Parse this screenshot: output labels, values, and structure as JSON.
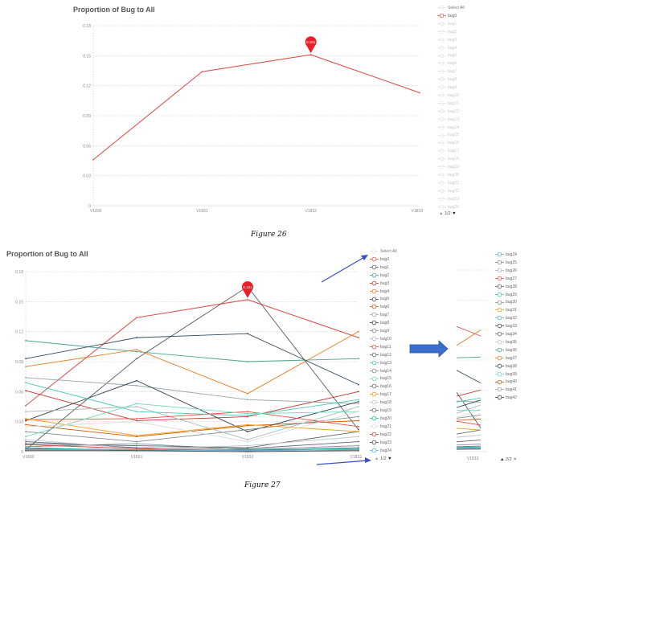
{
  "figure26": {
    "title": "Proportion of Bug to All",
    "caption": "Figure 26",
    "legend": {
      "select_all": "Select All",
      "items": [
        "bug0",
        "bug1",
        "bug2",
        "bug3",
        "bug4",
        "bug5",
        "bug6",
        "bug7",
        "bug8",
        "bug9",
        "bug10",
        "bug11",
        "bug12",
        "bug13",
        "bug14",
        "bug15",
        "bug16",
        "bug17",
        "bug18",
        "bug19",
        "bug20",
        "bug21",
        "bug22",
        "bug23",
        "bug24"
      ],
      "active": [
        "bug0"
      ],
      "pager": "1/2"
    }
  },
  "figure27": {
    "title": "Proportion of Bug to All",
    "caption": "Figure 27",
    "legend": {
      "select_all": "Select All",
      "items": [
        "bug0",
        "bug1",
        "bug2",
        "bug3",
        "bug4",
        "bug5",
        "bug6",
        "bug7",
        "bug8",
        "bug9",
        "bug10",
        "bug11",
        "bug12",
        "bug13",
        "bug14",
        "bug15",
        "bug16",
        "bug17",
        "bug18",
        "bug19",
        "bug20",
        "bug21",
        "bug22",
        "bug23",
        "bug24"
      ],
      "pager": "1/2"
    },
    "legend_page2": {
      "items": [
        "bug24",
        "bug25",
        "bug26",
        "bug27",
        "bug28",
        "bug29",
        "bug30",
        "bug31",
        "bug32",
        "bug33",
        "bug34",
        "bug35",
        "bug36",
        "bug37",
        "bug38",
        "bug39",
        "bug40",
        "bug41",
        "bug42"
      ],
      "pager": "2/2"
    }
  },
  "colors": {
    "bug0": "#d9534f",
    "grid": "#cccccc",
    "axis": "#999999",
    "marker": "#e8202a",
    "arrow": "#3a4fc0",
    "big_arrow": "#3a6fd0"
  },
  "icons": [
    "triangle-up-icon",
    "triangle-down-icon",
    "pin-marker-icon",
    "arrow-right-icon",
    "diamond-circle-icon"
  ],
  "chart_data": [
    {
      "type": "line",
      "title": "Proportion of Bug to All",
      "categories": [
        "V1830",
        "V1831",
        "V1832",
        "V1833"
      ],
      "yticks": [
        "0",
        "0.03",
        "0.06",
        "0.09",
        "0.12",
        "0.15",
        "0.18"
      ],
      "ylim": [
        0,
        0.18
      ],
      "grid": true,
      "legend_placement": "right",
      "annotation": {
        "category": "V1832",
        "label": "0.151"
      },
      "series": [
        {
          "name": "bug0",
          "color": "#d9534f",
          "values": [
            0.046,
            0.134,
            0.151,
            0.113
          ]
        }
      ]
    },
    {
      "type": "line",
      "title": "Proportion of Bug to All",
      "categories": [
        "V1830",
        "V1831",
        "V1832",
        "V1833"
      ],
      "yticks": [
        "0",
        "0.03",
        "0.06",
        "0.09",
        "0.12",
        "0.15",
        "0.18"
      ],
      "ylim": [
        0,
        0.18
      ],
      "grid": true,
      "legend_placement": "right",
      "annotation": {
        "category": "V1832",
        "label": "0.151"
      },
      "series": [
        {
          "name": "bug0",
          "color": "#d9534f",
          "values": [
            0.046,
            0.134,
            0.152,
            0.114
          ]
        },
        {
          "name": "bug1",
          "color": "#5a5a5a",
          "values": [
            0.002,
            0.093,
            0.165,
            0.022
          ]
        },
        {
          "name": "bug2",
          "color": "#4aa391",
          "values": [
            0.111,
            0.1,
            0.09,
            0.093
          ]
        },
        {
          "name": "bug3",
          "color": "#c0392b",
          "values": [
            0.061,
            0.031,
            0.035,
            0.06
          ]
        },
        {
          "name": "bug4",
          "color": "#e67e22",
          "values": [
            0.085,
            0.102,
            0.058,
            0.12
          ]
        },
        {
          "name": "bug5",
          "color": "#34495e",
          "values": [
            0.093,
            0.114,
            0.118,
            0.067
          ]
        },
        {
          "name": "bug6",
          "color": "#d35400",
          "values": [
            0.027,
            0.015,
            0.026,
            0.031
          ]
        },
        {
          "name": "bug7",
          "color": "#95a5a6",
          "values": [
            0.074,
            0.066,
            0.052,
            0.048
          ]
        },
        {
          "name": "bug8",
          "color": "#2c3e50",
          "values": [
            0.031,
            0.071,
            0.02,
            0.05
          ]
        },
        {
          "name": "bug9",
          "color": "#7f8c8d",
          "values": [
            0.02,
            0.01,
            0.022,
            0.035
          ]
        },
        {
          "name": "bug10",
          "color": "#aab7b8",
          "values": [
            0.04,
            0.045,
            0.012,
            0.045
          ]
        },
        {
          "name": "bug11",
          "color": "#e74c3c",
          "values": [
            0.032,
            0.033,
            0.04,
            0.025
          ]
        },
        {
          "name": "bug12",
          "color": "#566573",
          "values": [
            0.01,
            0.004,
            0.003,
            0.01
          ]
        },
        {
          "name": "bug13",
          "color": "#48c9b0",
          "values": [
            0.069,
            0.04,
            0.036,
            0.052
          ]
        },
        {
          "name": "bug14",
          "color": "#808b96",
          "values": [
            0.005,
            0.008,
            0.002,
            0.006
          ]
        },
        {
          "name": "bug15",
          "color": "#76d7c4",
          "values": [
            0.015,
            0.048,
            0.038,
            0.04
          ]
        },
        {
          "name": "bug16",
          "color": "#616a6b",
          "values": [
            0.008,
            0.006,
            0.004,
            0.02
          ]
        },
        {
          "name": "bug17",
          "color": "#f39c12",
          "values": [
            0.033,
            0.016,
            0.027,
            0.02
          ]
        },
        {
          "name": "bug18",
          "color": "#bdc3c7",
          "values": [
            0.012,
            0.003,
            0.006,
            0.015
          ]
        },
        {
          "name": "bug19",
          "color": "#5d6d7e",
          "values": [
            0.003,
            0.002,
            0.001,
            0.004
          ]
        },
        {
          "name": "bug20",
          "color": "#1abc9c",
          "values": [
            0.004,
            0.001,
            0.002,
            0.003
          ]
        },
        {
          "name": "bug21",
          "color": "#d5dbdb",
          "values": [
            0.025,
            0.03,
            0.01,
            0.04
          ]
        },
        {
          "name": "bug22",
          "color": "#cb4335",
          "values": [
            0.007,
            0.003,
            0.001,
            0.002
          ]
        },
        {
          "name": "bug23",
          "color": "#424949",
          "values": [
            0.001,
            0.001,
            0.0,
            0.001
          ]
        },
        {
          "name": "bug24",
          "color": "#5dade2",
          "values": [
            0.002,
            0.002,
            0.001,
            0.002
          ]
        }
      ]
    }
  ]
}
